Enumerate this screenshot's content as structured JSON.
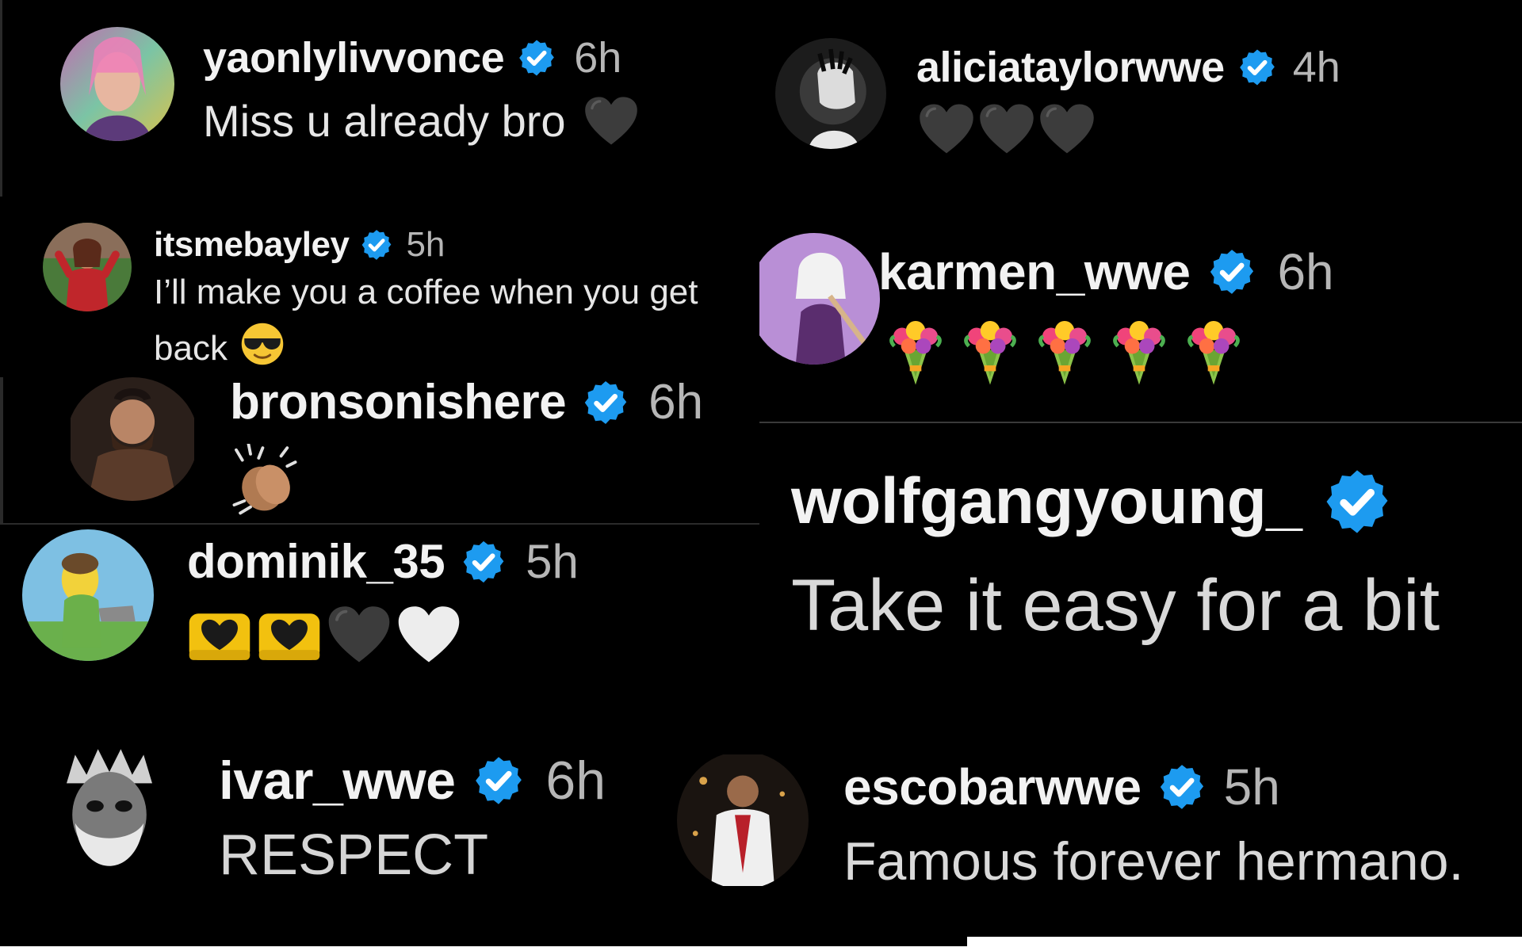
{
  "badge_color": "#1d9bf0",
  "comments": [
    {
      "id": "livvonce",
      "username": "yaonlylivvonce",
      "time": "6h",
      "text": "Miss u already bro",
      "emoji": [
        "black-heart-icon"
      ]
    },
    {
      "id": "alicia",
      "username": "aliciataylorwwe",
      "time": "4h",
      "text": "",
      "emoji": [
        "black-heart-icon",
        "black-heart-icon",
        "black-heart-icon"
      ]
    },
    {
      "id": "bayley",
      "username": "itsmebayley",
      "time": "5h",
      "text_line1": "I’ll make you a coffee when you get",
      "text_line2": "back",
      "emoji": [
        "sunglasses-face-icon"
      ]
    },
    {
      "id": "karmen",
      "username": "karmen_wwe",
      "time": "6h",
      "text": "",
      "emoji": [
        "bouquet-icon",
        "bouquet-icon",
        "bouquet-icon",
        "bouquet-icon",
        "bouquet-icon"
      ]
    },
    {
      "id": "bronson",
      "username": "bronsonishere",
      "time": "6h",
      "text": "",
      "emoji": [
        "clapping-hands-icon"
      ]
    },
    {
      "id": "wolfgang",
      "username": "wolfgangyoung_",
      "time": "",
      "text": "Take it easy for a bit",
      "emoji": []
    },
    {
      "id": "dominik",
      "username": "dominik_35",
      "time": "5h",
      "text": "",
      "emoji": [
        "heart-hands-icon",
        "heart-hands-icon",
        "black-heart-icon",
        "white-heart-icon"
      ]
    },
    {
      "id": "ivar",
      "username": "ivar_wwe",
      "time": "6h",
      "text": "RESPECT",
      "emoji": []
    },
    {
      "id": "escobar",
      "username": "escobarwwe",
      "time": "5h",
      "text": "Famous forever hermano.",
      "emoji": []
    }
  ]
}
